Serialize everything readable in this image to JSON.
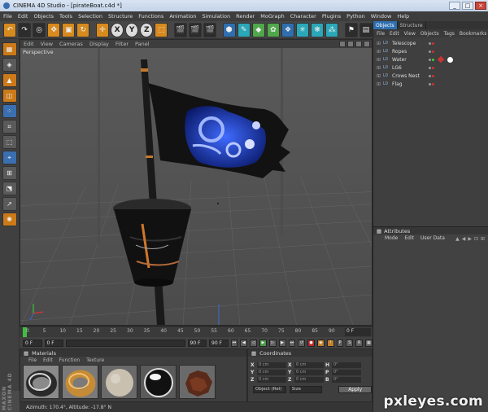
{
  "window": {
    "title": "CINEMA 4D Studio - [pirateBoat.c4d *]",
    "min": "_",
    "max": "□",
    "close": "×"
  },
  "menu": [
    "File",
    "Edit",
    "Objects",
    "Tools",
    "Selection",
    "Structure",
    "Functions",
    "Animation",
    "Simulation",
    "Render",
    "MoGraph",
    "Character",
    "Plugins",
    "Python",
    "Window",
    "Help"
  ],
  "toolbar": {
    "icons": [
      {
        "name": "undo-icon",
        "glyph": "↶",
        "style": "orange"
      },
      {
        "name": "redo-icon",
        "glyph": "↷",
        "style": "dark"
      },
      {
        "name": "live-selection-icon",
        "glyph": "◎",
        "style": "dark"
      },
      {
        "name": "move-icon",
        "glyph": "✥",
        "style": "orange"
      },
      {
        "name": "scale-icon",
        "glyph": "▣",
        "style": "orange"
      },
      {
        "name": "rotate-icon",
        "glyph": "↻",
        "style": "orange"
      },
      {
        "name": "sep",
        "glyph": "",
        "style": "sep"
      },
      {
        "name": "world-coords-icon",
        "glyph": "✛",
        "style": "orange"
      },
      {
        "name": "x-axis-icon",
        "glyph": "X",
        "style": "circle"
      },
      {
        "name": "y-axis-icon",
        "glyph": "Y",
        "style": "circle"
      },
      {
        "name": "z-axis-icon",
        "glyph": "Z",
        "style": "circle"
      },
      {
        "name": "coordinate-system-icon",
        "glyph": "⬚",
        "style": "orange"
      },
      {
        "name": "sep",
        "glyph": "",
        "style": "sep"
      },
      {
        "name": "render-view-icon",
        "glyph": "🎬",
        "style": "dark"
      },
      {
        "name": "render-picture-viewer-icon",
        "glyph": "🎬",
        "style": "dark"
      },
      {
        "name": "render-settings-icon",
        "glyph": "🎬",
        "style": "dark"
      },
      {
        "name": "sep",
        "glyph": "",
        "style": "sep"
      },
      {
        "name": "cube-icon",
        "glyph": "⬢",
        "style": "blue"
      },
      {
        "name": "spline-pen-icon",
        "glyph": "✎",
        "style": "cyan"
      },
      {
        "name": "subdivision-icon",
        "glyph": "◆",
        "style": "green"
      },
      {
        "name": "array-icon",
        "glyph": "✿",
        "style": "green"
      },
      {
        "name": "deformer-icon",
        "glyph": "❖",
        "style": "blue"
      },
      {
        "name": "scene-icon",
        "glyph": "✳",
        "style": "cyan"
      },
      {
        "name": "light-icon",
        "glyph": "❋",
        "style": "cyan"
      },
      {
        "name": "camera-icon",
        "glyph": "⁂",
        "style": "cyan"
      },
      {
        "name": "sep",
        "glyph": "",
        "style": "sep"
      },
      {
        "name": "hair-icon",
        "glyph": "⚑",
        "style": "dark"
      },
      {
        "name": "layout-icon",
        "glyph": "▤",
        "style": "dark"
      }
    ]
  },
  "lefttools": [
    {
      "name": "make-editable-icon",
      "glyph": "▦",
      "style": "orange"
    },
    {
      "name": "model-mode-icon",
      "glyph": "◈",
      "style": ""
    },
    {
      "name": "object-mode-icon",
      "glyph": "▲",
      "style": "orange"
    },
    {
      "name": "texture-mode-icon",
      "glyph": "◫",
      "style": "orange"
    },
    {
      "name": "points-mode-icon",
      "glyph": "⁘",
      "style": "blue"
    },
    {
      "name": "edges-mode-icon",
      "glyph": "⌗",
      "style": ""
    },
    {
      "name": "polygons-mode-icon",
      "glyph": "⬚",
      "style": ""
    },
    {
      "name": "uv-mode-icon",
      "glyph": "⌖",
      "style": "blue"
    },
    {
      "name": "snap-icon",
      "glyph": "⊞",
      "style": ""
    },
    {
      "name": "workplane-icon",
      "glyph": "⬔",
      "style": ""
    },
    {
      "name": "axis-mode-icon",
      "glyph": "↗",
      "style": ""
    },
    {
      "name": "sculpt-icon",
      "glyph": "✺",
      "style": "orange"
    }
  ],
  "maxon_logo": "MAXON CINEMA 4D",
  "viewport": {
    "menu": [
      "View",
      "Cameras",
      "Display",
      "Filter",
      "Panel"
    ],
    "label": "Perspective",
    "edit_label": "Edit"
  },
  "timeline": {
    "ticks": [
      "0",
      "5",
      "10",
      "15",
      "20",
      "25",
      "30",
      "35",
      "40",
      "45",
      "50",
      "55",
      "60",
      "65",
      "70",
      "75",
      "80",
      "85",
      "90"
    ],
    "frame": "0 F"
  },
  "transport": {
    "start": "0 F",
    "current": "0 F",
    "end_min": "90 F",
    "end_max": "90 F"
  },
  "materials": {
    "title": "Materials",
    "menu": [
      "File",
      "Edit",
      "Function",
      "Texture"
    ],
    "swatches": [
      "chrome-ring",
      "gold-ring",
      "sand",
      "mirror-sphere",
      "wood-ball"
    ]
  },
  "coords": {
    "title": "Coordinates",
    "rows": [
      {
        "a": "X",
        "v": "0 cm",
        "b": "X",
        "v2": "0 cm",
        "c": "H",
        "v3": "0°"
      },
      {
        "a": "Y",
        "v": "0 cm",
        "b": "Y",
        "v2": "0 cm",
        "c": "P",
        "v3": "0°"
      },
      {
        "a": "Z",
        "v": "0 cm",
        "b": "Z",
        "v2": "0 cm",
        "c": "B",
        "v3": "0°"
      }
    ],
    "mode": "Object (Rel)",
    "size_mode": "Size",
    "apply": "Apply"
  },
  "status": "Azimuth: 170.4°, Altitude: -17.8°  N",
  "objects_panel": {
    "tabs": [
      "Objects",
      "Structure"
    ],
    "menu": [
      "File",
      "Edit",
      "View",
      "Objects",
      "Tags",
      "Bookmarks"
    ],
    "items": [
      {
        "name": "Telescope",
        "tag": ""
      },
      {
        "name": "Ropes",
        "tag": ""
      },
      {
        "name": "Water",
        "tag": "sphere"
      },
      {
        "name": "LG6",
        "tag": ""
      },
      {
        "name": "Crows Nest",
        "tag": ""
      },
      {
        "name": "Flag",
        "tag": ""
      }
    ]
  },
  "attributes_panel": {
    "title": "Attributes",
    "menu": [
      "Mode",
      "Edit",
      "User Data"
    ]
  },
  "watermark": "pxleyes.com",
  "colors": {
    "accent": "#2f6fb0",
    "flag_blue": "#1f3fbf",
    "orange": "#d78a1e"
  }
}
